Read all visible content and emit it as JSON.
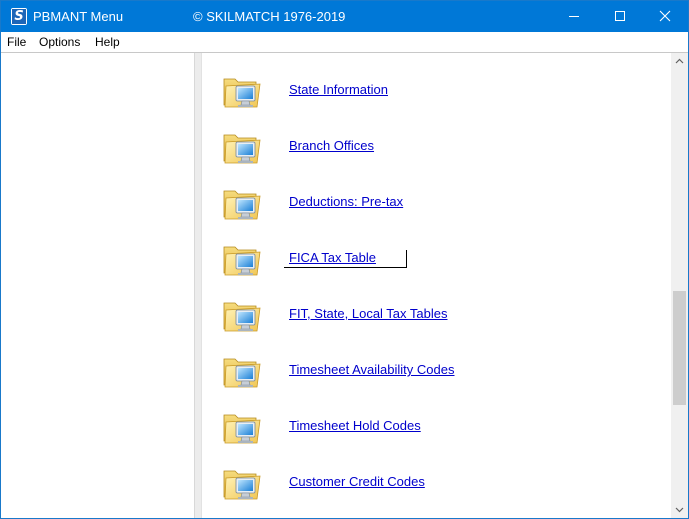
{
  "window": {
    "title": "PBMANT Menu",
    "copyright": "© SKILMATCH 1976-2019",
    "app_icon_letter": "S"
  },
  "menu": {
    "file": "File",
    "options": "Options",
    "help": "Help"
  },
  "items": [
    {
      "label": "State Information"
    },
    {
      "label": "Branch Offices"
    },
    {
      "label": "Deductions:  Pre-tax"
    },
    {
      "label": "FICA Tax Table",
      "focused": true
    },
    {
      "label": "FIT, State, Local Tax Tables"
    },
    {
      "label": "Timesheet Availability Codes"
    },
    {
      "label": "Timesheet Hold Codes"
    },
    {
      "label": "Customer Credit Codes"
    }
  ],
  "icons": {
    "item_icon": "folder-computer-icon",
    "minimize": "minimize-icon",
    "maximize": "maximize-icon",
    "close": "close-icon"
  },
  "colors": {
    "titlebar": "#0078d7",
    "link": "#0000cc"
  }
}
